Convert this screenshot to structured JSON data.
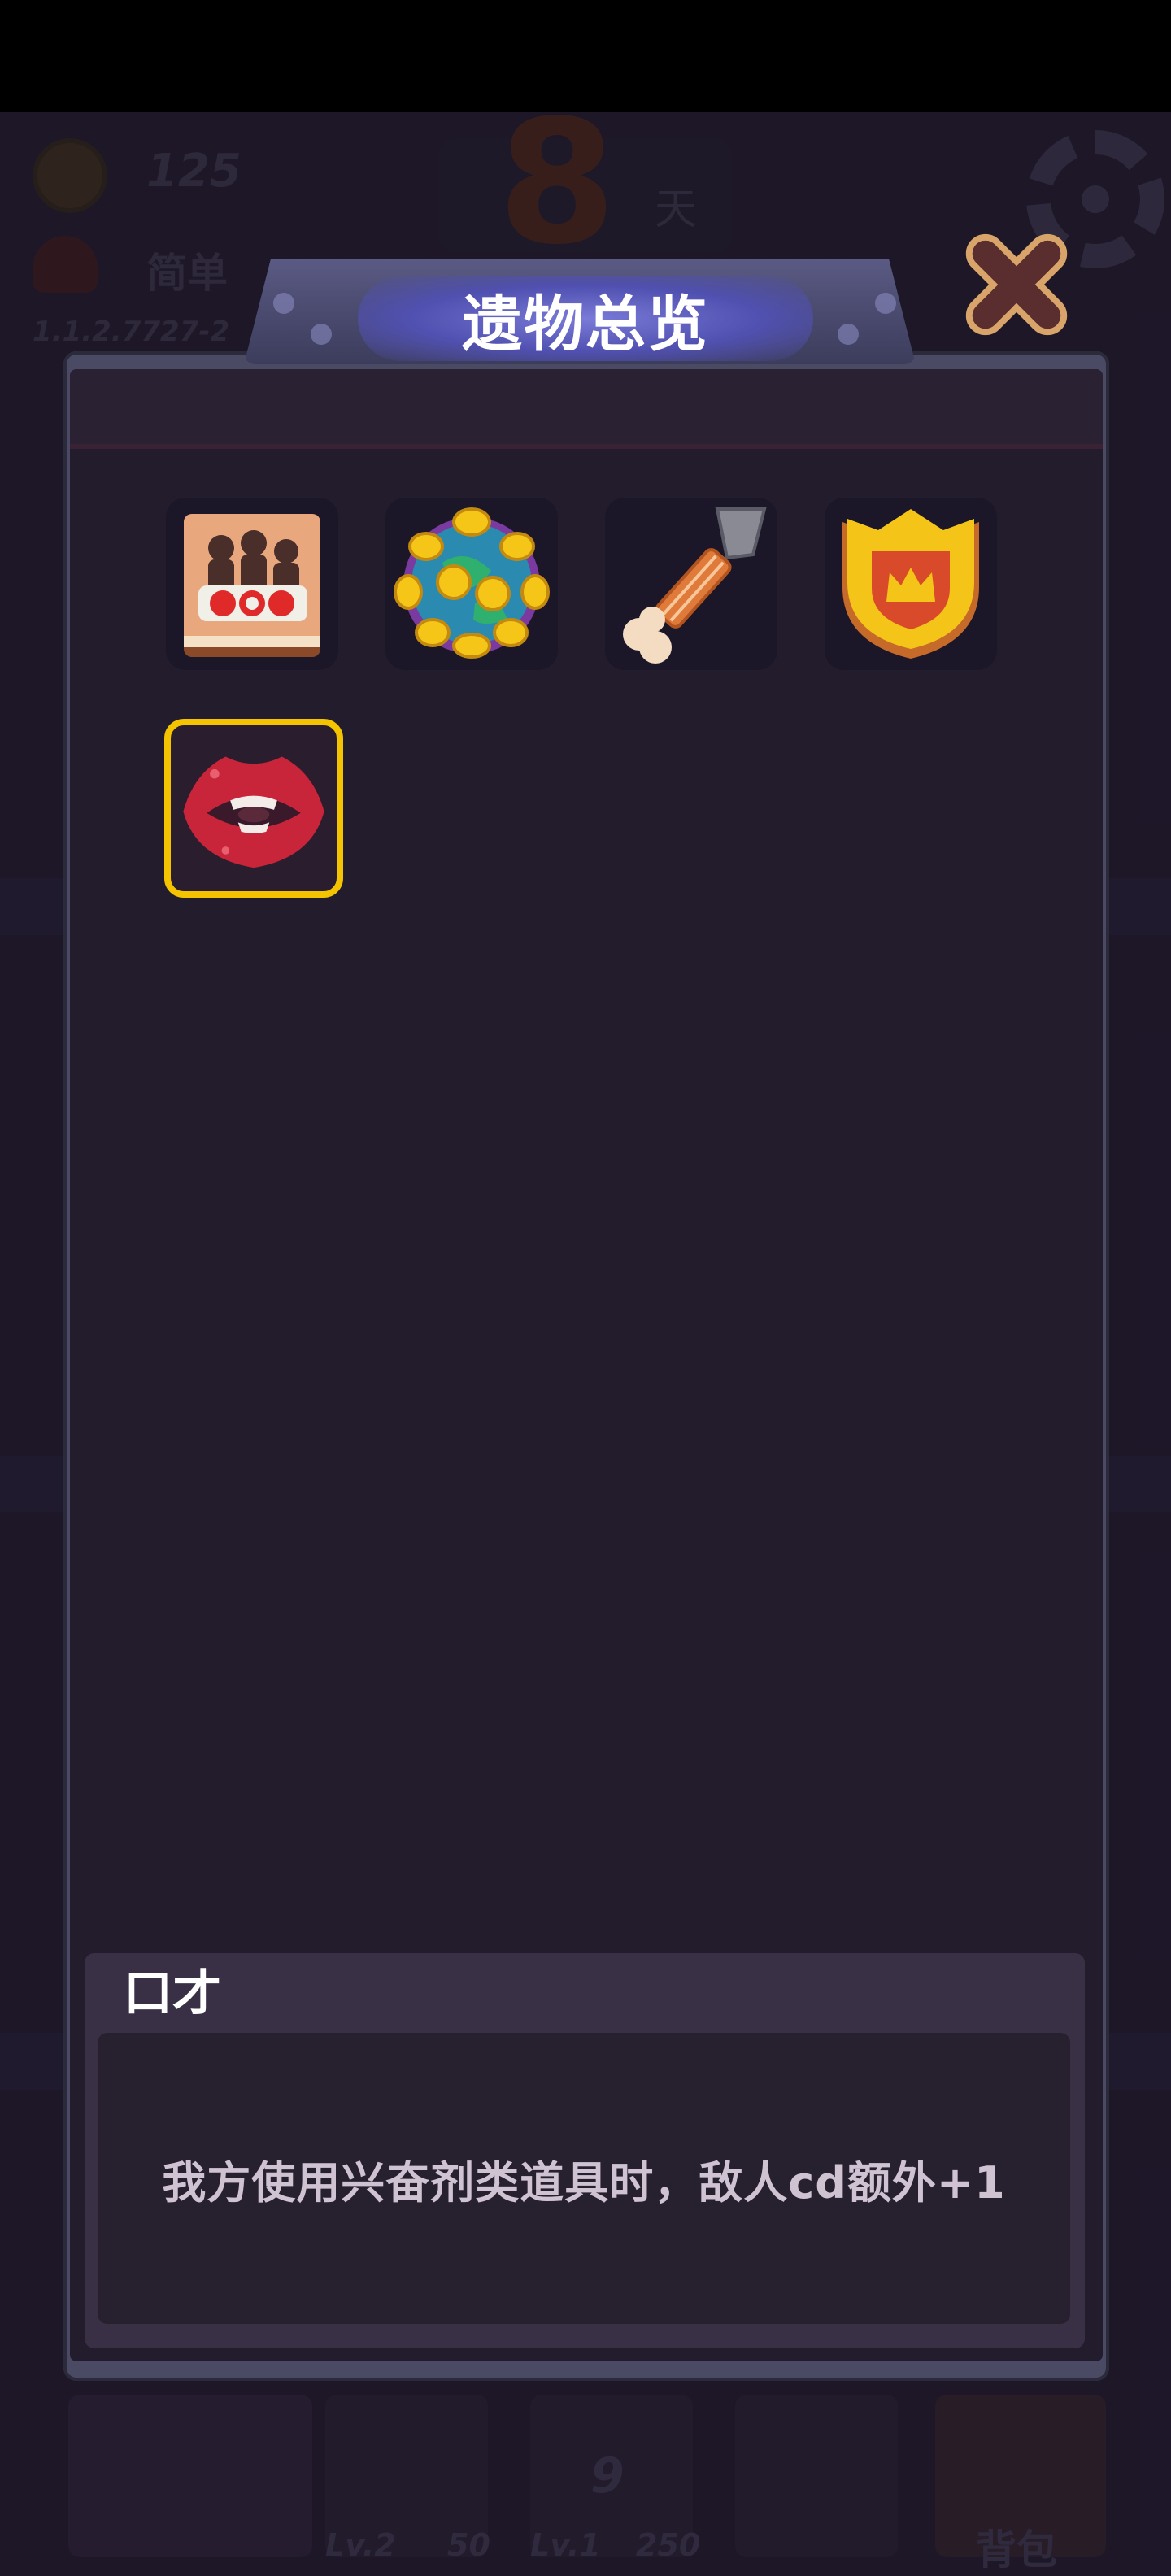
{
  "hud": {
    "coins": "125",
    "difficulty": "简单",
    "version": "1.1.2.7727-2",
    "day_number": "8",
    "day_unit": "天"
  },
  "bottom_bar": {
    "slots": [
      {
        "level": "Lv.2",
        "value": "50"
      },
      {
        "level": "Lv.1",
        "value": "250",
        "badge": "9"
      }
    ],
    "backpack_label": "背包"
  },
  "dialog": {
    "title": "遗物总览",
    "close_icon": "close-x-icon",
    "relics": [
      {
        "icon": "sos-book-icon",
        "selected": false
      },
      {
        "icon": "spiked-orb-icon",
        "selected": false
      },
      {
        "icon": "syringe-bone-icon",
        "selected": false
      },
      {
        "icon": "crown-shield-icon",
        "selected": false
      },
      {
        "icon": "mouth-lips-icon",
        "selected": true
      }
    ],
    "selected_relic": {
      "name": "口才",
      "description": "我方使用兴奋剂类道具时，敌人cd额外+1"
    }
  },
  "colors": {
    "selection_border": "#f5c400",
    "panel_bg": "#231c2d",
    "title_glow": "#6a6ad0"
  }
}
